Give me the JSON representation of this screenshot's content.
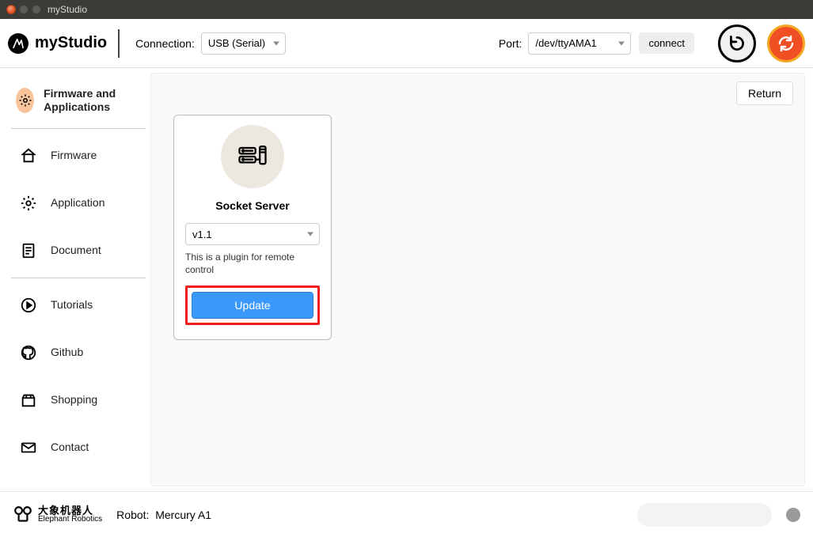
{
  "window": {
    "title": "myStudio"
  },
  "header": {
    "app_name": "myStudio",
    "connection_label": "Connection:",
    "connection_selected": "USB (Serial)",
    "port_label": "Port:",
    "port_selected": "/dev/ttyAMA1",
    "connect_label": "connect"
  },
  "sidebar": {
    "items": [
      {
        "label": "Firmware and Applications"
      },
      {
        "label": "Firmware"
      },
      {
        "label": "Application"
      },
      {
        "label": "Document"
      },
      {
        "label": "Tutorials"
      },
      {
        "label": "Github"
      },
      {
        "label": "Shopping"
      },
      {
        "label": "Contact"
      }
    ]
  },
  "main": {
    "return_label": "Return",
    "card": {
      "title": "Socket Server",
      "version_selected": "v1.1",
      "description": "This is a plugin for remote control",
      "update_label": "Update"
    }
  },
  "footer": {
    "brand_cn": "大象机器人",
    "brand_en": "Elephant Robotics",
    "robot_label": "Robot:",
    "robot_value": "Mercury A1"
  }
}
